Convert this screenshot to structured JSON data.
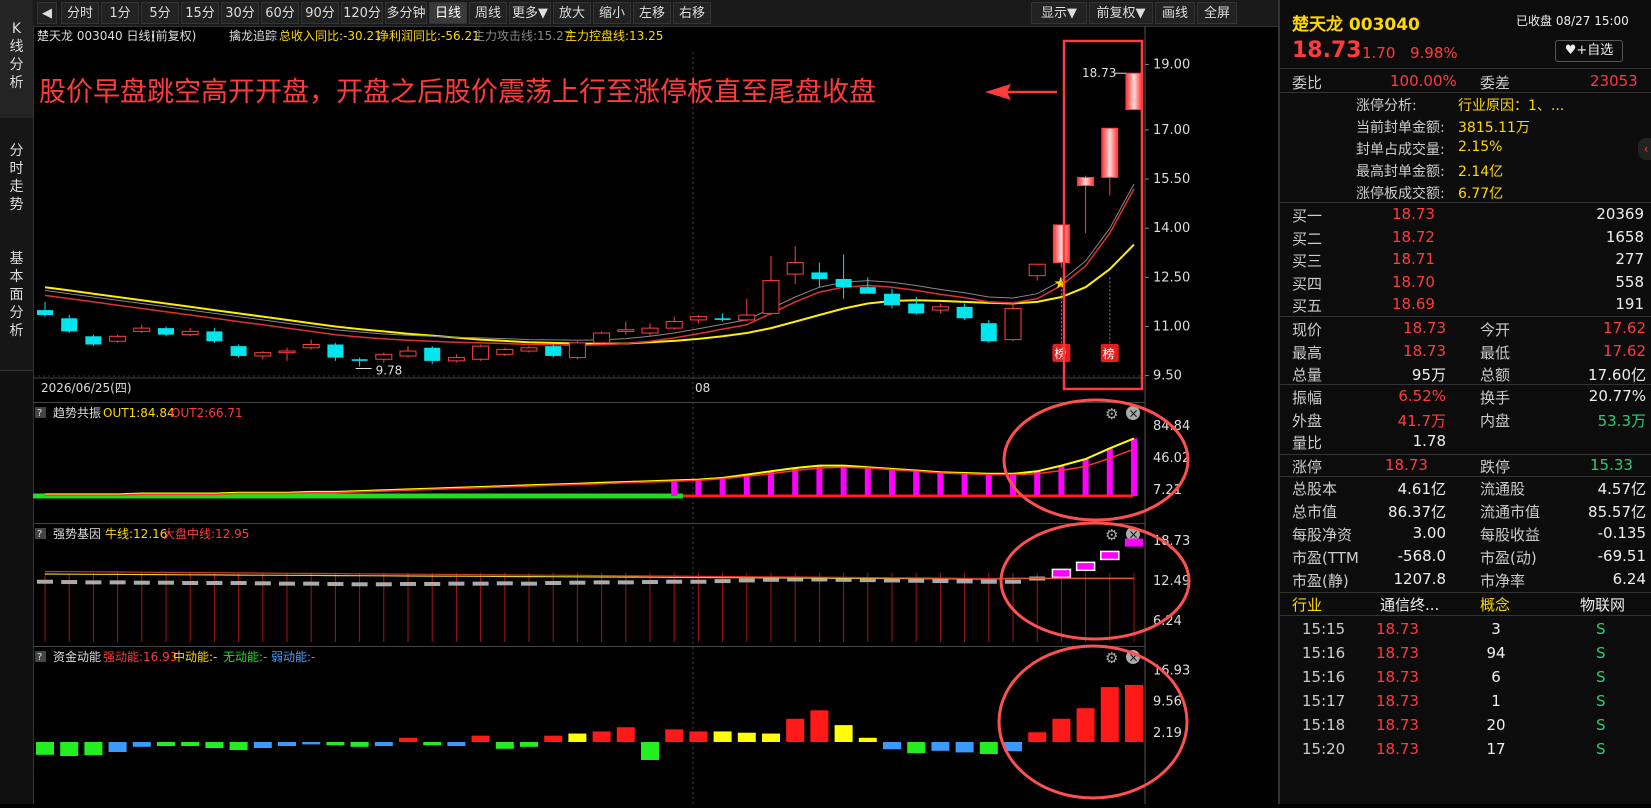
{
  "left_tabs": [
    "K线分析",
    "分时走势",
    "基本面分析"
  ],
  "toolbar": {
    "items": [
      "分时",
      "1分",
      "5分",
      "15分",
      "30分",
      "60分",
      "90分",
      "120分",
      "多分钟",
      "日线",
      "周线",
      "更多▼",
      "放大",
      "缩小",
      "左移",
      "右移"
    ],
    "right_items": [
      "显示▼",
      "前复权▼",
      "画线",
      "全屏"
    ],
    "active": "日线"
  },
  "chart_header": {
    "title": "楚天龙 003040 日线)",
    "adjust": "(前复权)",
    "indicator": "擒龙追踪",
    "revenue_yoy": "总收入同比:-30.21",
    "profit_yoy": "净利润同比:-56.21",
    "attack_line": "主力攻击线:15.27",
    "control_line": "主力控盘线:13.25"
  },
  "annotation": "股价早盘跳空高开开盘，开盘之后股价震荡上行至涨停板直至尾盘收盘",
  "price_axis": [
    "19.00",
    "17.00",
    "15.50",
    "14.00",
    "12.50",
    "11.00",
    "9.50"
  ],
  "date_labels": [
    "2026/06/25(四)",
    "08"
  ],
  "low_label": "9.78",
  "high_label": "18.73",
  "bang": "榜",
  "panels": {
    "trend": {
      "name": "趋势共振",
      "out1": "OUT1:84.84",
      "out2": "OUT2:66.71",
      "axis": [
        "84.84",
        "46.02",
        "7.21"
      ]
    },
    "gene": {
      "name": "强势基因",
      "bull": "牛线:12.16",
      "market": "大盘中线:12.95",
      "axis": [
        "18.73",
        "12.49",
        "6.24"
      ]
    },
    "fund": {
      "name": "资金动能",
      "strong": "强动能:16.93",
      "mid": "中动能:-",
      "none": "无动能:-",
      "weak": "弱动能:-",
      "axis": [
        "16.93",
        "9.56",
        "2.19"
      ]
    }
  },
  "stock": {
    "name": "楚天龙 003040",
    "status": "已收盘 08/27 15:00",
    "price": "18.73",
    "change": "1.70",
    "pct": "9.98%",
    "watch_btn": "+自选",
    "weibi_lbl": "委比",
    "weibi": "100.00%",
    "weicha_lbl": "委差",
    "weicha": "23053",
    "limit_info": [
      {
        "k": "涨停分析:",
        "v": "行业原因：1、..."
      },
      {
        "k": "当前封单金额:",
        "v": "3815.11万"
      },
      {
        "k": "封单占成交量:",
        "v": "2.15%"
      },
      {
        "k": "最高封单金额:",
        "v": "2.14亿"
      },
      {
        "k": "涨停板成交额:",
        "v": "6.77亿"
      }
    ],
    "bids": [
      {
        "k": "买一",
        "p": "18.73",
        "v": "20369"
      },
      {
        "k": "买二",
        "p": "18.72",
        "v": "1658"
      },
      {
        "k": "买三",
        "p": "18.71",
        "v": "277"
      },
      {
        "k": "买四",
        "p": "18.70",
        "v": "558"
      },
      {
        "k": "买五",
        "p": "18.69",
        "v": "191"
      }
    ],
    "quote": [
      {
        "k1": "现价",
        "v1": "18.73",
        "c1": "red",
        "k2": "今开",
        "v2": "17.62",
        "c2": "red"
      },
      {
        "k1": "最高",
        "v1": "18.73",
        "c1": "red",
        "k2": "最低",
        "v2": "17.62",
        "c2": "red"
      },
      {
        "k1": "总量",
        "v1": "95万",
        "c1": "white",
        "k2": "总额",
        "v2": "17.60亿",
        "c2": "white"
      }
    ],
    "stats": [
      {
        "k1": "振幅",
        "v1": "6.52%",
        "c1": "red",
        "k2": "换手",
        "v2": "20.77%",
        "c2": "white"
      },
      {
        "k1": "外盘",
        "v1": "41.7万",
        "c1": "red",
        "k2": "内盘",
        "v2": "53.3万",
        "c2": "green"
      },
      {
        "k1": "量比",
        "v1": "1.78",
        "c1": "white",
        "k2": "",
        "v2": "",
        "c2": "white"
      }
    ],
    "limits": {
      "k1": "涨停",
      "v1": "18.73",
      "k2": "跌停",
      "v2": "15.33"
    },
    "fundamentals": [
      {
        "k1": "总股本",
        "v1": "4.61亿",
        "k2": "流通股",
        "v2": "4.57亿"
      },
      {
        "k1": "总市值",
        "v1": "86.37亿",
        "k2": "流通市值",
        "v2": "85.57亿"
      },
      {
        "k1": "每股净资",
        "v1": "3.00",
        "k2": "每股收益",
        "v2": "-0.135"
      },
      {
        "k1": "市盈(TTM",
        "v1": "-568.0",
        "k2": "市盈(动)",
        "v2": "-69.51"
      },
      {
        "k1": "市盈(静)",
        "v1": "1207.8",
        "k2": "市净率",
        "v2": "6.24"
      }
    ],
    "industry": {
      "k1": "行业",
      "v1": "通信终...",
      "k2": "概念",
      "v2": "物联网"
    },
    "ticks": [
      {
        "t": "15:15",
        "p": "18.73",
        "v": "3",
        "s": "S"
      },
      {
        "t": "15:16",
        "p": "18.73",
        "v": "94",
        "s": "S"
      },
      {
        "t": "15:16",
        "p": "18.73",
        "v": "6",
        "s": "S"
      },
      {
        "t": "15:17",
        "p": "18.73",
        "v": "1",
        "s": "S"
      },
      {
        "t": "15:18",
        "p": "18.73",
        "v": "20",
        "s": "S"
      },
      {
        "t": "15:20",
        "p": "18.73",
        "v": "17",
        "s": "S"
      }
    ]
  },
  "chart_data": {
    "type": "candlestick",
    "y_range": [
      9.0,
      19.5
    ],
    "candles": [
      {
        "o": 11.5,
        "h": 11.75,
        "l": 11.3,
        "c": 11.35
      },
      {
        "o": 11.25,
        "h": 11.35,
        "l": 10.8,
        "c": 10.85
      },
      {
        "o": 10.7,
        "h": 10.75,
        "l": 10.4,
        "c": 10.45
      },
      {
        "o": 10.55,
        "h": 10.75,
        "l": 10.5,
        "c": 10.7
      },
      {
        "o": 10.85,
        "h": 11.05,
        "l": 10.8,
        "c": 10.95
      },
      {
        "o": 10.95,
        "h": 11.0,
        "l": 10.7,
        "c": 10.75
      },
      {
        "o": 10.75,
        "h": 10.95,
        "l": 10.7,
        "c": 10.85
      },
      {
        "o": 10.85,
        "h": 10.95,
        "l": 10.5,
        "c": 10.55
      },
      {
        "o": 10.4,
        "h": 10.45,
        "l": 10.05,
        "c": 10.1
      },
      {
        "o": 10.1,
        "h": 10.25,
        "l": 10.0,
        "c": 10.2
      },
      {
        "o": 10.2,
        "h": 10.35,
        "l": 9.95,
        "c": 10.25
      },
      {
        "o": 10.35,
        "h": 10.6,
        "l": 10.3,
        "c": 10.45
      },
      {
        "o": 10.45,
        "h": 10.5,
        "l": 9.95,
        "c": 10.05
      },
      {
        "o": 10.0,
        "h": 10.05,
        "l": 9.78,
        "c": 9.95
      },
      {
        "o": 10.0,
        "h": 10.2,
        "l": 9.9,
        "c": 10.15
      },
      {
        "o": 10.1,
        "h": 10.4,
        "l": 10.05,
        "c": 10.25
      },
      {
        "o": 10.35,
        "h": 10.4,
        "l": 9.85,
        "c": 9.95
      },
      {
        "o": 9.95,
        "h": 10.15,
        "l": 9.9,
        "c": 10.05
      },
      {
        "o": 10.0,
        "h": 10.45,
        "l": 9.95,
        "c": 10.4
      },
      {
        "o": 10.15,
        "h": 10.35,
        "l": 10.1,
        "c": 10.3
      },
      {
        "o": 10.25,
        "h": 10.4,
        "l": 10.2,
        "c": 10.35
      },
      {
        "o": 10.4,
        "h": 10.45,
        "l": 10.05,
        "c": 10.1
      },
      {
        "o": 10.05,
        "h": 10.55,
        "l": 10.0,
        "c": 10.5
      },
      {
        "o": 10.5,
        "h": 10.85,
        "l": 10.45,
        "c": 10.8
      },
      {
        "o": 10.85,
        "h": 11.15,
        "l": 10.75,
        "c": 10.9
      },
      {
        "o": 10.8,
        "h": 11.1,
        "l": 10.7,
        "c": 10.95
      },
      {
        "o": 10.95,
        "h": 11.3,
        "l": 10.9,
        "c": 11.15
      },
      {
        "o": 11.2,
        "h": 11.35,
        "l": 11.1,
        "c": 11.3
      },
      {
        "o": 11.25,
        "h": 11.4,
        "l": 11.15,
        "c": 11.2
      },
      {
        "o": 11.2,
        "h": 11.85,
        "l": 11.15,
        "c": 11.35
      },
      {
        "o": 11.4,
        "h": 13.15,
        "l": 11.35,
        "c": 12.4
      },
      {
        "o": 12.6,
        "h": 13.45,
        "l": 12.3,
        "c": 12.95
      },
      {
        "o": 12.65,
        "h": 12.95,
        "l": 12.2,
        "c": 12.45
      },
      {
        "o": 12.45,
        "h": 13.2,
        "l": 11.85,
        "c": 12.2
      },
      {
        "o": 12.2,
        "h": 12.5,
        "l": 12.05,
        "c": 12.0
      },
      {
        "o": 12.0,
        "h": 12.15,
        "l": 11.55,
        "c": 11.65
      },
      {
        "o": 11.7,
        "h": 11.9,
        "l": 11.35,
        "c": 11.4
      },
      {
        "o": 11.5,
        "h": 11.7,
        "l": 11.4,
        "c": 11.6
      },
      {
        "o": 11.6,
        "h": 11.7,
        "l": 11.2,
        "c": 11.25
      },
      {
        "o": 11.1,
        "h": 11.2,
        "l": 10.5,
        "c": 10.55
      },
      {
        "o": 10.6,
        "h": 11.7,
        "l": 10.55,
        "c": 11.55
      },
      {
        "o": 12.55,
        "h": 12.9,
        "l": 12.4,
        "c": 12.9
      },
      {
        "o": 12.95,
        "h": 14.1,
        "l": 12.8,
        "c": 14.1
      },
      {
        "o": 15.3,
        "h": 15.6,
        "l": 13.85,
        "c": 15.55
      },
      {
        "o": 15.55,
        "h": 17.05,
        "l": 15.0,
        "c": 17.05
      },
      {
        "o": 17.62,
        "h": 18.73,
        "l": 17.62,
        "c": 18.73
      }
    ],
    "ma_fast": [
      11.95,
      11.85,
      11.75,
      11.65,
      11.55,
      11.45,
      11.35,
      11.25,
      11.15,
      11.05,
      10.95,
      10.85,
      10.75,
      10.68,
      10.62,
      10.58,
      10.55,
      10.52,
      10.5,
      10.48,
      10.45,
      10.44,
      10.43,
      10.44,
      10.48,
      10.55,
      10.65,
      10.78,
      10.92,
      11.05,
      11.4,
      11.75,
      12.05,
      12.2,
      12.25,
      12.2,
      12.1,
      11.98,
      11.88,
      11.75,
      11.72,
      11.85,
      12.25,
      12.85,
      13.85,
      15.2
    ],
    "ma_slow": [
      12.2,
      12.1,
      12.0,
      11.9,
      11.8,
      11.7,
      11.6,
      11.5,
      11.4,
      11.3,
      11.2,
      11.1,
      11.0,
      10.92,
      10.85,
      10.78,
      10.72,
      10.66,
      10.6,
      10.56,
      10.52,
      10.5,
      10.48,
      10.47,
      10.48,
      10.52,
      10.56,
      10.62,
      10.7,
      10.8,
      10.95,
      11.15,
      11.35,
      11.55,
      11.7,
      11.78,
      11.8,
      11.78,
      11.75,
      11.72,
      11.7,
      11.75,
      11.9,
      12.2,
      12.75,
      13.5
    ],
    "trend_values": [
      2,
      2,
      2,
      2,
      3,
      3,
      3,
      3,
      4,
      4,
      4,
      5,
      5,
      6,
      7,
      8,
      9,
      10,
      11,
      12,
      13,
      14,
      15,
      16,
      17,
      18,
      19,
      20,
      22,
      26,
      30,
      34,
      37,
      37,
      35,
      33,
      31,
      29,
      28,
      27,
      27,
      30,
      37,
      45,
      58,
      70
    ],
    "trend_line2": [
      1,
      1,
      1,
      1,
      2,
      2,
      2,
      2,
      3,
      3,
      3,
      4,
      4,
      5,
      6,
      7,
      8,
      9,
      10,
      11,
      12,
      13,
      14,
      15,
      16,
      17,
      18,
      19,
      21,
      24,
      27,
      31,
      34,
      35,
      34,
      32,
      30,
      28,
      27,
      26,
      26,
      27,
      31,
      36,
      46,
      57
    ],
    "gene_values": [
      12.4,
      12.35,
      12.3,
      12.3,
      12.25,
      12.25,
      12.2,
      12.2,
      12.2,
      12.15,
      12.1,
      12.1,
      12.05,
      12.0,
      12.0,
      12.05,
      12.05,
      12.1,
      12.1,
      12.15,
      12.1,
      12.2,
      12.25,
      12.3,
      12.3,
      12.35,
      12.4,
      12.4,
      12.5,
      12.6,
      12.7,
      12.75,
      12.75,
      12.7,
      12.65,
      12.6,
      12.55,
      12.5,
      12.45,
      12.4,
      12.4,
      12.9,
      13.7,
      14.8,
      16.5,
      18.5
    ],
    "fund_values": [
      3.2,
      3.5,
      3.3,
      2.5,
      1.2,
      1.0,
      1.0,
      1.5,
      2.0,
      1.5,
      1.0,
      0.6,
      0.8,
      1.2,
      1.0,
      1.0,
      0.8,
      1.0,
      1.5,
      1.7,
      1.2,
      1.5,
      2.0,
      2.5,
      3.5,
      4.5,
      3.0,
      2.5,
      2.5,
      2.2,
      2.0,
      5.5,
      7.5,
      4.0,
      1.0,
      1.8,
      2.8,
      2.2,
      2.6,
      3.0,
      2.3,
      2.3,
      5.5,
      8.0,
      13.0,
      13.5
    ],
    "fund_colors": [
      "green",
      "green",
      "green",
      "blue",
      "blue",
      "green",
      "green",
      "green",
      "green",
      "blue",
      "blue",
      "blue",
      "green",
      "green",
      "blue",
      "red",
      "green",
      "blue",
      "red",
      "green",
      "green",
      "red",
      "yellow",
      "red",
      "red",
      "green",
      "red",
      "red",
      "yellow",
      "yellow",
      "yellow",
      "red",
      "red",
      "yellow",
      "yellow",
      "blue",
      "green",
      "blue",
      "blue",
      "green",
      "blue",
      "red",
      "red",
      "red",
      "red",
      "red"
    ]
  }
}
